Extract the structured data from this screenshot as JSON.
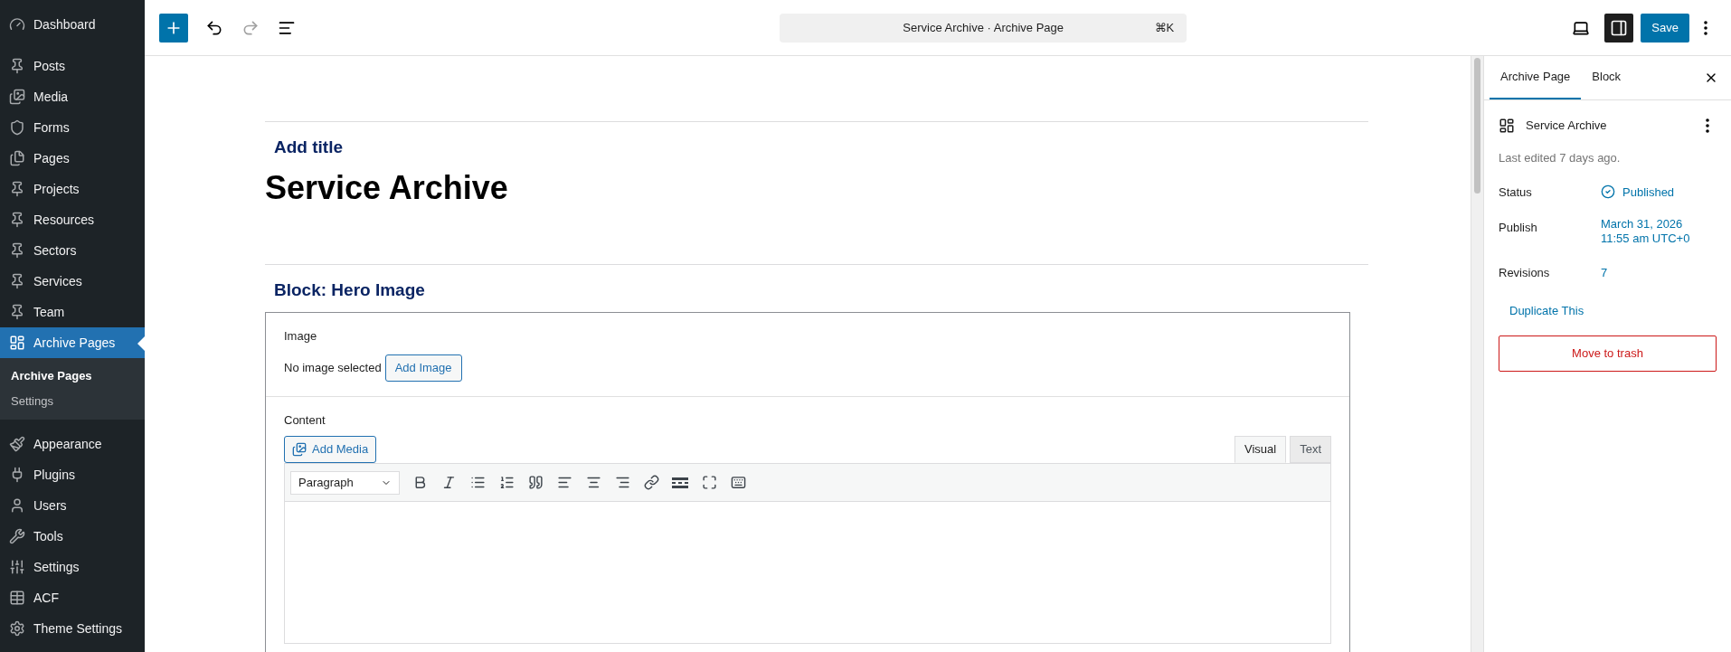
{
  "admin_menu": {
    "items": [
      {
        "label": "Dashboard",
        "selected": false
      },
      {
        "label": "Posts",
        "selected": false
      },
      {
        "label": "Media",
        "selected": false
      },
      {
        "label": "Forms",
        "selected": false
      },
      {
        "label": "Pages",
        "selected": false
      },
      {
        "label": "Projects",
        "selected": false
      },
      {
        "label": "Resources",
        "selected": false
      },
      {
        "label": "Sectors",
        "selected": false
      },
      {
        "label": "Services",
        "selected": false
      },
      {
        "label": "Team",
        "selected": false
      },
      {
        "label": "Archive Pages",
        "selected": true,
        "submenu": [
          {
            "label": "Archive Pages",
            "selected": true
          },
          {
            "label": "Settings",
            "selected": false
          }
        ]
      },
      {
        "label": "Appearance",
        "selected": false
      },
      {
        "label": "Plugins",
        "selected": false
      },
      {
        "label": "Users",
        "selected": false
      },
      {
        "label": "Tools",
        "selected": false
      },
      {
        "label": "Settings",
        "selected": false
      },
      {
        "label": "ACF",
        "selected": false
      },
      {
        "label": "Theme Settings",
        "selected": false
      }
    ]
  },
  "top_bar": {
    "command_title": "Service Archive · Archive Page",
    "shortcut": "⌘K",
    "save": "Save",
    "settings_open": true
  },
  "editor": {
    "title_label": "Add title",
    "title": "Service Archive",
    "block_title": "Block: Hero Image",
    "image_field": {
      "label": "Image",
      "status": "No image selected",
      "button": "Add Image"
    },
    "content_field": {
      "label": "Content",
      "add_media": "Add Media",
      "tabs": [
        {
          "label": "Visual",
          "selected": true
        },
        {
          "label": "Text",
          "selected": false
        }
      ],
      "format": "Paragraph"
    }
  },
  "settings_panel": {
    "tabs": [
      {
        "label": "Archive Page",
        "selected": true
      },
      {
        "label": "Block",
        "selected": false
      }
    ],
    "page_title": "Service Archive",
    "last_edited": "Last edited 7 days ago.",
    "rows": [
      {
        "label": "Status",
        "value": "Published",
        "kind": "status"
      },
      {
        "label": "Publish",
        "value": "March 31, 2026",
        "value_2": "11:55 am UTC+0",
        "kind": "date"
      },
      {
        "label": "Revisions",
        "value": "7",
        "kind": "link"
      }
    ],
    "duplicate": "Duplicate This",
    "trash": "Move to trash"
  }
}
